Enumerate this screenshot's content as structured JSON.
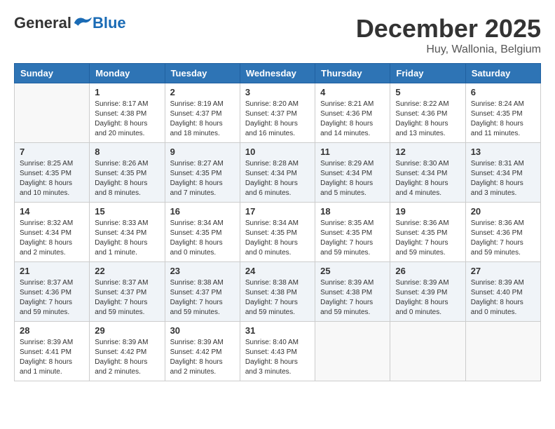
{
  "logo": {
    "general": "General",
    "blue": "Blue"
  },
  "title": "December 2025",
  "location": "Huy, Wallonia, Belgium",
  "headers": [
    "Sunday",
    "Monday",
    "Tuesday",
    "Wednesday",
    "Thursday",
    "Friday",
    "Saturday"
  ],
  "weeks": [
    [
      {
        "day": "",
        "content": ""
      },
      {
        "day": "1",
        "content": "Sunrise: 8:17 AM\nSunset: 4:38 PM\nDaylight: 8 hours\nand 20 minutes."
      },
      {
        "day": "2",
        "content": "Sunrise: 8:19 AM\nSunset: 4:37 PM\nDaylight: 8 hours\nand 18 minutes."
      },
      {
        "day": "3",
        "content": "Sunrise: 8:20 AM\nSunset: 4:37 PM\nDaylight: 8 hours\nand 16 minutes."
      },
      {
        "day": "4",
        "content": "Sunrise: 8:21 AM\nSunset: 4:36 PM\nDaylight: 8 hours\nand 14 minutes."
      },
      {
        "day": "5",
        "content": "Sunrise: 8:22 AM\nSunset: 4:36 PM\nDaylight: 8 hours\nand 13 minutes."
      },
      {
        "day": "6",
        "content": "Sunrise: 8:24 AM\nSunset: 4:35 PM\nDaylight: 8 hours\nand 11 minutes."
      }
    ],
    [
      {
        "day": "7",
        "content": "Sunrise: 8:25 AM\nSunset: 4:35 PM\nDaylight: 8 hours\nand 10 minutes."
      },
      {
        "day": "8",
        "content": "Sunrise: 8:26 AM\nSunset: 4:35 PM\nDaylight: 8 hours\nand 8 minutes."
      },
      {
        "day": "9",
        "content": "Sunrise: 8:27 AM\nSunset: 4:35 PM\nDaylight: 8 hours\nand 7 minutes."
      },
      {
        "day": "10",
        "content": "Sunrise: 8:28 AM\nSunset: 4:34 PM\nDaylight: 8 hours\nand 6 minutes."
      },
      {
        "day": "11",
        "content": "Sunrise: 8:29 AM\nSunset: 4:34 PM\nDaylight: 8 hours\nand 5 minutes."
      },
      {
        "day": "12",
        "content": "Sunrise: 8:30 AM\nSunset: 4:34 PM\nDaylight: 8 hours\nand 4 minutes."
      },
      {
        "day": "13",
        "content": "Sunrise: 8:31 AM\nSunset: 4:34 PM\nDaylight: 8 hours\nand 3 minutes."
      }
    ],
    [
      {
        "day": "14",
        "content": "Sunrise: 8:32 AM\nSunset: 4:34 PM\nDaylight: 8 hours\nand 2 minutes."
      },
      {
        "day": "15",
        "content": "Sunrise: 8:33 AM\nSunset: 4:34 PM\nDaylight: 8 hours\nand 1 minute."
      },
      {
        "day": "16",
        "content": "Sunrise: 8:34 AM\nSunset: 4:35 PM\nDaylight: 8 hours\nand 0 minutes."
      },
      {
        "day": "17",
        "content": "Sunrise: 8:34 AM\nSunset: 4:35 PM\nDaylight: 8 hours\nand 0 minutes."
      },
      {
        "day": "18",
        "content": "Sunrise: 8:35 AM\nSunset: 4:35 PM\nDaylight: 7 hours\nand 59 minutes."
      },
      {
        "day": "19",
        "content": "Sunrise: 8:36 AM\nSunset: 4:35 PM\nDaylight: 7 hours\nand 59 minutes."
      },
      {
        "day": "20",
        "content": "Sunrise: 8:36 AM\nSunset: 4:36 PM\nDaylight: 7 hours\nand 59 minutes."
      }
    ],
    [
      {
        "day": "21",
        "content": "Sunrise: 8:37 AM\nSunset: 4:36 PM\nDaylight: 7 hours\nand 59 minutes."
      },
      {
        "day": "22",
        "content": "Sunrise: 8:37 AM\nSunset: 4:37 PM\nDaylight: 7 hours\nand 59 minutes."
      },
      {
        "day": "23",
        "content": "Sunrise: 8:38 AM\nSunset: 4:37 PM\nDaylight: 7 hours\nand 59 minutes."
      },
      {
        "day": "24",
        "content": "Sunrise: 8:38 AM\nSunset: 4:38 PM\nDaylight: 7 hours\nand 59 minutes."
      },
      {
        "day": "25",
        "content": "Sunrise: 8:39 AM\nSunset: 4:38 PM\nDaylight: 7 hours\nand 59 minutes."
      },
      {
        "day": "26",
        "content": "Sunrise: 8:39 AM\nSunset: 4:39 PM\nDaylight: 8 hours\nand 0 minutes."
      },
      {
        "day": "27",
        "content": "Sunrise: 8:39 AM\nSunset: 4:40 PM\nDaylight: 8 hours\nand 0 minutes."
      }
    ],
    [
      {
        "day": "28",
        "content": "Sunrise: 8:39 AM\nSunset: 4:41 PM\nDaylight: 8 hours\nand 1 minute."
      },
      {
        "day": "29",
        "content": "Sunrise: 8:39 AM\nSunset: 4:42 PM\nDaylight: 8 hours\nand 2 minutes."
      },
      {
        "day": "30",
        "content": "Sunrise: 8:39 AM\nSunset: 4:42 PM\nDaylight: 8 hours\nand 2 minutes."
      },
      {
        "day": "31",
        "content": "Sunrise: 8:40 AM\nSunset: 4:43 PM\nDaylight: 8 hours\nand 3 minutes."
      },
      {
        "day": "",
        "content": ""
      },
      {
        "day": "",
        "content": ""
      },
      {
        "day": "",
        "content": ""
      }
    ]
  ]
}
